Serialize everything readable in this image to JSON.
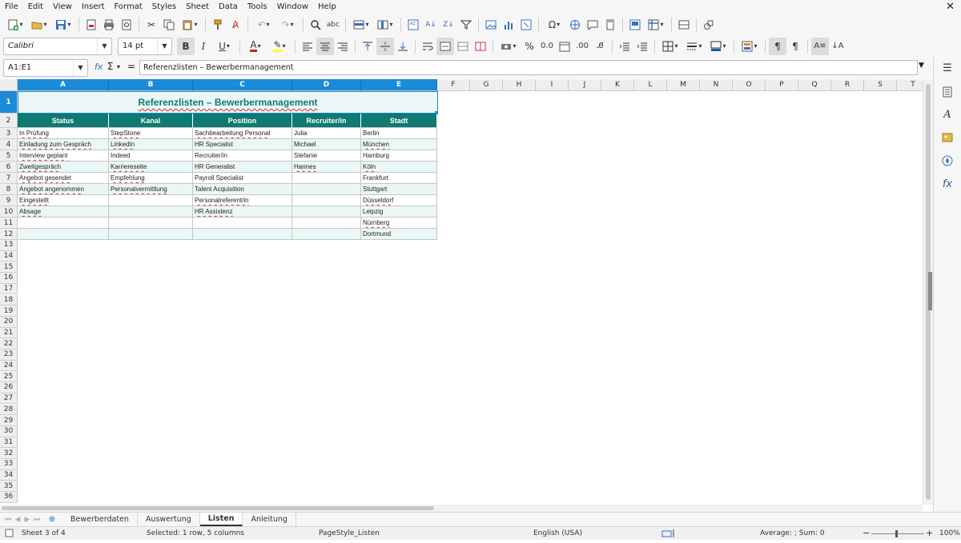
{
  "menu": [
    "File",
    "Edit",
    "View",
    "Insert",
    "Format",
    "Styles",
    "Sheet",
    "Data",
    "Tools",
    "Window",
    "Help"
  ],
  "window": {
    "close_glyph": "✕"
  },
  "format_toolbar": {
    "font_name": "Calibri",
    "font_size": "14 pt"
  },
  "formula_bar": {
    "name_box": "A1:E1",
    "formula": "Referenzlisten – Bewerbermanagement"
  },
  "columns": [
    "A",
    "B",
    "C",
    "D",
    "E",
    "F",
    "G",
    "H",
    "I",
    "J",
    "K",
    "L",
    "M",
    "N",
    "O",
    "P",
    "Q",
    "R",
    "S",
    "T"
  ],
  "rows": [
    "1",
    "2",
    "3",
    "4",
    "5",
    "6",
    "7",
    "8",
    "9",
    "10",
    "11",
    "12",
    "13",
    "14",
    "15",
    "16",
    "17",
    "18",
    "19",
    "20",
    "21",
    "22",
    "23",
    "24",
    "25",
    "26",
    "27",
    "28",
    "29",
    "30",
    "31",
    "32",
    "33",
    "34",
    "35",
    "36"
  ],
  "sheet": {
    "title": "Referenzlisten – Bewerbermanagement",
    "headers": [
      "Status",
      "Kanal",
      "Position",
      "Recruiter/in",
      "Stadt"
    ],
    "data": [
      [
        "In Prüfung",
        "StepStone",
        "Sachbearbeitung Personal",
        "Julia",
        "Berlin"
      ],
      [
        "Einladung zum Gespräch",
        "LinkedIn",
        "HR Specialist",
        "Michael",
        "München"
      ],
      [
        "Interview geplant",
        "Indeed",
        "Recruiter/in",
        "Stefanie",
        "Hamburg"
      ],
      [
        "Zweitgespräch",
        "Karriereseite",
        "HR Generalist",
        "Hannes",
        "Köln"
      ],
      [
        "Angebot gesendet",
        "Empfehlung",
        "Payroll Specialist",
        "",
        "Frankfurt"
      ],
      [
        "Angebot angenommen",
        "Personalvermittlung",
        "Talent Acquisition",
        "",
        "Stuttgart"
      ],
      [
        "Eingestellt",
        "",
        "Personalreferent/in",
        "",
        "Düsseldorf"
      ],
      [
        "Absage",
        "",
        "HR Assistenz",
        "",
        "Leipzig"
      ],
      [
        "",
        "",
        "",
        "",
        "Nürnberg"
      ],
      [
        "",
        "",
        "",
        "",
        "Dortmund"
      ]
    ]
  },
  "tabs": [
    "Bewerberdaten",
    "Auswertung",
    "Listen",
    "Anleitung"
  ],
  "active_tab": "Listen",
  "status": {
    "sheet": "Sheet 3 of 4",
    "selection": "Selected: 1 row, 5 columns",
    "page_style": "PageStyle_Listen",
    "language": "English (USA)",
    "sum": "Average: ; Sum: 0",
    "zoom": "100%"
  },
  "colors": {
    "header_bg": "#0e7a72",
    "alt_row": "#eaf7f6",
    "selection": "#1c8ad6"
  }
}
